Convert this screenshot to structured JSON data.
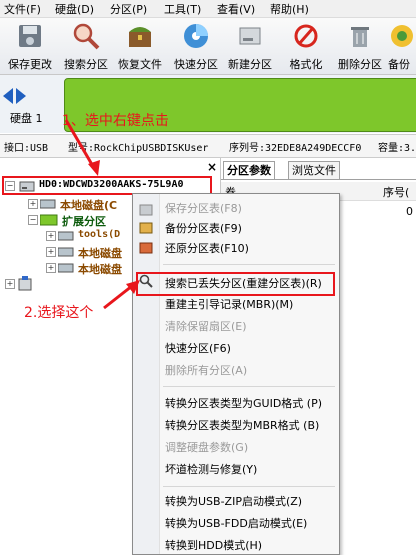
{
  "menubar": {
    "items": [
      "文件(F)",
      "硬盘(D)",
      "分区(P)",
      "工具(T)",
      "查看(V)",
      "帮助(H)"
    ]
  },
  "toolbar": {
    "buttons": [
      "保存更改",
      "搜索分区",
      "恢复文件",
      "快速分区",
      "新建分区",
      "格式化",
      "删除分区",
      "备份"
    ]
  },
  "diskbar": {
    "disk_label": "硬盘 1"
  },
  "info": {
    "interface": "接口:USB",
    "model": "型号:RockChipUSBDISKUser",
    "serial": "序列号:32EDE8A249DECCF0",
    "capacity": "容量:3."
  },
  "tree": {
    "disk": "HD0:WDCWD3200AAKS-75L9A0",
    "items": [
      "本地磁盘(C",
      "扩展分区",
      "tools(D",
      "本地磁盘",
      "本地磁盘"
    ]
  },
  "tabs": [
    "分区参数",
    "浏览文件"
  ],
  "right_table": {
    "header_left": "卷",
    "header_right": "序号(",
    "value": "0"
  },
  "context_menu": {
    "items": [
      {
        "label": "保存分区表(F8)",
        "enabled": false
      },
      {
        "label": "备份分区表(F9)",
        "enabled": true
      },
      {
        "label": "还原分区表(F10)",
        "enabled": true
      },
      {
        "label": "搜索已丢失分区(重建分区表)(R)",
        "enabled": true
      },
      {
        "label": "重建主引导记录(MBR)(M)",
        "enabled": true
      },
      {
        "label": "清除保留扇区(E)",
        "enabled": false
      },
      {
        "label": "快速分区(F6)",
        "enabled": true
      },
      {
        "label": "删除所有分区(A)",
        "enabled": false
      },
      {
        "label": "转换分区表类型为GUID格式 (P)",
        "enabled": true
      },
      {
        "label": "转换分区表类型为MBR格式 (B)",
        "enabled": true
      },
      {
        "label": "调整硬盘参数(G)",
        "enabled": false
      },
      {
        "label": "坏道检测与修复(Y)",
        "enabled": true
      },
      {
        "label": "转换为USB-ZIP启动模式(Z)",
        "enabled": true
      },
      {
        "label": "转换为USB-FDD启动模式(E)",
        "enabled": true
      },
      {
        "label": "转换到HDD模式(H)",
        "enabled": true
      }
    ]
  },
  "annotations": {
    "step1": "1、选中右键点击",
    "step2": "2.选择这个"
  },
  "colors": {
    "annotation": "#e8161c",
    "disk_bar": "#7ec72b",
    "toolbar_bg": "#eef1f5"
  }
}
